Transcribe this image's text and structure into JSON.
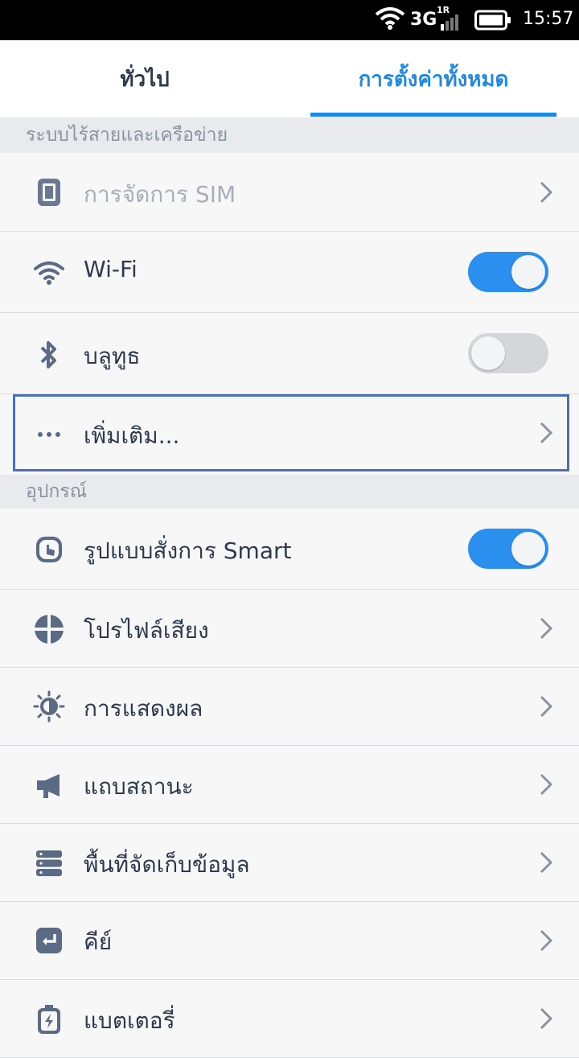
{
  "status_bar": {
    "network": "3G",
    "sim_badge": "1R",
    "time": "15:57"
  },
  "tabs": [
    {
      "label": "ทั่วไป",
      "active": false
    },
    {
      "label": "การตั้งค่าทั้งหมด",
      "active": true
    }
  ],
  "sections": [
    {
      "header": "ระบบไร้สายและเครือข่าย",
      "items": [
        {
          "label": "การจัดการ SIM",
          "icon": "sim-icon",
          "control": "chevron",
          "disabled": true
        },
        {
          "label": "Wi-Fi",
          "icon": "wifi-icon",
          "control": "toggle",
          "on": true
        },
        {
          "label": "บลูทูธ",
          "icon": "bluetooth-icon",
          "control": "toggle",
          "on": false
        },
        {
          "label": "เพิ่มเติม...",
          "icon": "more-icon",
          "control": "chevron",
          "highlighted": true
        }
      ]
    },
    {
      "header": "อุปกรณ์",
      "items": [
        {
          "label": "รูปแบบสั่งการ Smart",
          "icon": "smart-gesture-icon",
          "control": "toggle",
          "on": true
        },
        {
          "label": "โปรไฟล์เสียง",
          "icon": "sound-profile-icon",
          "control": "chevron"
        },
        {
          "label": "การแสดงผล",
          "icon": "display-icon",
          "control": "chevron"
        },
        {
          "label": "แถบสถานะ",
          "icon": "status-bar-icon",
          "control": "chevron"
        },
        {
          "label": "พื้นที่จัดเก็บข้อมูล",
          "icon": "storage-icon",
          "control": "chevron"
        },
        {
          "label": "คีย์",
          "icon": "key-icon",
          "control": "chevron"
        },
        {
          "label": "แบตเตอรี่",
          "icon": "battery-icon",
          "control": "chevron"
        }
      ]
    }
  ],
  "colors": {
    "accent": "#1e88e5",
    "toggle_on": "#2b8ff0",
    "icon": "#5b6b86",
    "highlight_border": "#4a6fb5"
  }
}
